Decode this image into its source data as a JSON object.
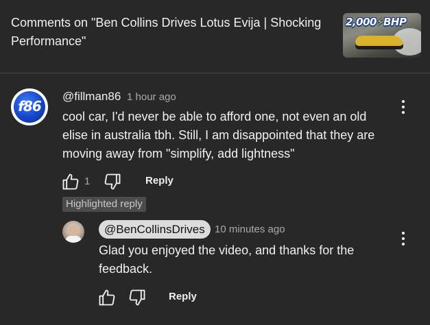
{
  "header": {
    "title": "Comments on \"Ben Collins Drives Lotus Evija | Shocking Performance\"",
    "thumbnail_text_number": "2,000",
    "thumbnail_text_unit": "BHP"
  },
  "comments": [
    {
      "author": "@fillman86",
      "avatar_text": "f86",
      "time": "1 hour ago",
      "text": "cool car, I'd never be able to afford one, not even an old elise in australia tbh. Still, I am disappointed that they are moving away from \"simplify, add lightness\"",
      "like_count": "1",
      "reply_label": "Reply"
    }
  ],
  "highlighted_label": "Highlighted reply",
  "replies": [
    {
      "author": "@BenCollinsDrives",
      "time": "10 minutes ago",
      "text": "Glad you enjoyed the video, and thanks for the feedback.",
      "reply_label": "Reply"
    }
  ],
  "icons": {
    "like": "thumbs-up-icon",
    "dislike": "thumbs-down-icon",
    "menu": "more-vert-icon"
  },
  "colors": {
    "background": "#282828",
    "text": "#f1f1f1",
    "secondary_text": "#aaaaaa",
    "creator_chip": "#dcdcdc"
  }
}
